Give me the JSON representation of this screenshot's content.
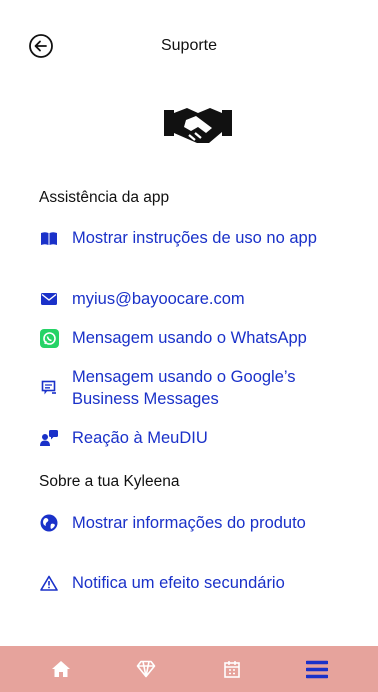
{
  "header": {
    "title": "Suporte"
  },
  "colors": {
    "link": "#1a31c9",
    "tabbar": "#e6a39c",
    "active_tab": "#1a31c9",
    "whatsapp": "#25d366"
  },
  "sections": [
    {
      "title": "Assistência da app",
      "items": [
        {
          "icon": "book-icon",
          "label": "Mostrar instruções de uso no app"
        },
        {
          "icon": "envelope-icon",
          "label": "myius@bayoocare.com"
        },
        {
          "icon": "whatsapp-icon",
          "label": "Mensagem usando o WhatsApp"
        },
        {
          "icon": "chat-icon",
          "label": "Mensagem usando o Google’s Business Messages"
        },
        {
          "icon": "feedback-icon",
          "label": "Reação à MeuDIU"
        }
      ]
    },
    {
      "title": "Sobre a tua Kyleena",
      "items": [
        {
          "icon": "globe-icon",
          "label": "Mostrar informações do produto"
        },
        {
          "icon": "warning-icon",
          "label": "Notifica um efeito secundário"
        }
      ]
    }
  ],
  "tabbar": {
    "tabs": [
      {
        "icon": "home-icon",
        "active": false
      },
      {
        "icon": "diamond-icon",
        "active": false
      },
      {
        "icon": "calendar-icon",
        "active": false
      },
      {
        "icon": "menu-icon",
        "active": true
      }
    ]
  }
}
